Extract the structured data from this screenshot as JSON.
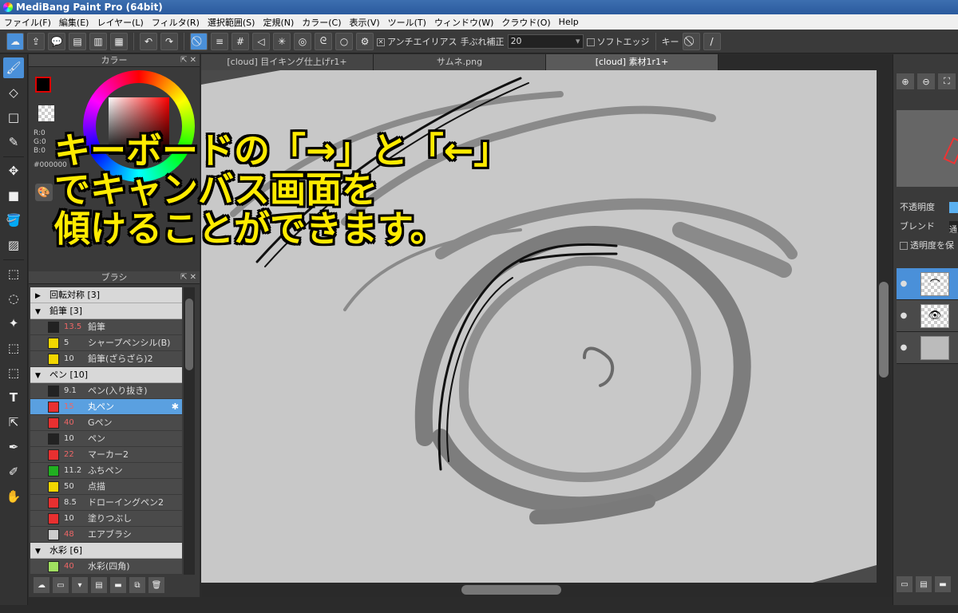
{
  "window": {
    "title": "MediBang Paint Pro (64bit)"
  },
  "menu": [
    "ファイル(F)",
    "編集(E)",
    "レイヤー(L)",
    "フィルタ(R)",
    "選択範囲(S)",
    "定規(N)",
    "カラー(C)",
    "表示(V)",
    "ツール(T)",
    "ウィンドウ(W)",
    "クラウド(O)",
    "Help"
  ],
  "toolbar": {
    "antialias_label": "アンチエイリアス",
    "stabilizer_label": "手ぶれ補正",
    "stabilizer_value": "20",
    "soft_edge_label": "ソフトエッジ",
    "key_label": "キー"
  },
  "color_panel": {
    "title": "カラー",
    "rgb": [
      "R:0",
      "G:0",
      "B:0"
    ],
    "hex": "#000000",
    "accent": "#4a90d9"
  },
  "brush_panel": {
    "title": "ブラシ",
    "groups": [
      {
        "name": "回転対称 [3]",
        "expanded": false,
        "items": []
      },
      {
        "name": "鉛筆 [3]",
        "expanded": true,
        "items": [
          {
            "size": "13.5",
            "name": "鉛筆",
            "color": "#222222",
            "size_red": true
          },
          {
            "size": "5",
            "name": "シャープペンシル(B)",
            "color": "#f2d600",
            "size_red": false
          },
          {
            "size": "10",
            "name": "鉛筆(ざらざら)2",
            "color": "#f2d600",
            "size_red": false
          }
        ]
      },
      {
        "name": "ペン [10]",
        "expanded": true,
        "items": [
          {
            "size": "9.1",
            "name": "ペン(入り抜き)",
            "color": "#222222",
            "size_red": false
          },
          {
            "size": "15",
            "name": "丸ペン",
            "color": "#e83030",
            "size_red": true,
            "selected": true
          },
          {
            "size": "40",
            "name": "Gペン",
            "color": "#e83030",
            "size_red": true
          },
          {
            "size": "10",
            "name": "ペン",
            "color": "#222222",
            "size_red": false
          },
          {
            "size": "22",
            "name": "マーカー2",
            "color": "#e83030",
            "size_red": true
          },
          {
            "size": "11.2",
            "name": "ふちペン",
            "color": "#20b020",
            "size_red": false
          },
          {
            "size": "50",
            "name": "点描",
            "color": "#f2d600",
            "size_red": false
          },
          {
            "size": "8.5",
            "name": "ドローイングペン2",
            "color": "#e83030",
            "size_red": false
          },
          {
            "size": "10",
            "name": "塗りつぶし",
            "color": "#e83030",
            "size_red": false
          },
          {
            "size": "48",
            "name": "エアブラシ",
            "color": "#cccccc",
            "size_red": true
          }
        ]
      },
      {
        "name": "水彩 [6]",
        "expanded": true,
        "items": [
          {
            "size": "40",
            "name": "水彩(四角)",
            "color": "#a0e060",
            "size_red": true
          }
        ]
      }
    ]
  },
  "tabs": [
    "[cloud] 目イキング仕上げr1+",
    "サムネ.png",
    "[cloud] 素材1r1+"
  ],
  "overlay_text": [
    "キーボードの「→」と「←」",
    "でキャンバス画面を",
    "傾けることができます。"
  ],
  "right_panel": {
    "opacity_label": "不透明度",
    "blend_label": "ブレンド",
    "blend_value": "通",
    "lock_alpha_label": "透明度を保"
  },
  "icons": {
    "undo": "undo-icon",
    "redo": "redo-icon",
    "brush": "brush-icon",
    "eraser": "eraser-icon",
    "move": "move-icon",
    "text": "text-icon",
    "hand": "hand-icon",
    "gear": "gear-icon"
  }
}
